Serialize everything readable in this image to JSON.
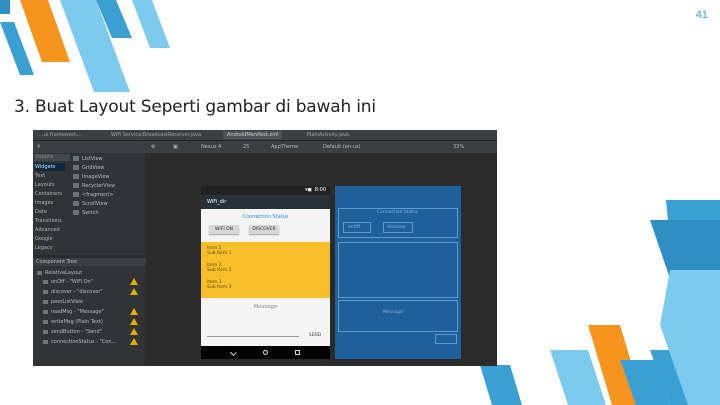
{
  "slide": {
    "page_number": "41",
    "title": "3. Buat Layout Seperti gambar di bawah ini"
  },
  "colors": {
    "accent_blue": "#3aa0d4",
    "accent_light_blue": "#7ccbee",
    "accent_orange": "#f7941d",
    "ide_bg": "#2b2b2b",
    "phone_list": "#f9bf2b",
    "blueprint": "#1f5f9a"
  },
  "ide": {
    "tabs": [
      "...ui.framework...",
      "WiFi Service/BroadcastReceiver.java",
      "AndroidManifest.xml",
      "MainActivity.java"
    ],
    "toolbar": {
      "device": "Nexus 4",
      "api": "25",
      "theme": "AppTheme",
      "language": "Default (en-us)",
      "zoom": "33%"
    },
    "palette": {
      "search_placeholder": "Palette",
      "categories": [
        "Widgets",
        "Text",
        "Layouts",
        "Containers",
        "Images",
        "Date",
        "Transitions",
        "Advanced",
        "Google",
        "Legacy"
      ],
      "items": [
        "ListView",
        "GridView",
        "ImageView",
        "RecyclerView",
        "<fragment>",
        "ScrollView",
        "Switch"
      ]
    },
    "component_tree": {
      "header": "Component Tree",
      "rows": [
        {
          "label": "RelativeLayout",
          "warn": false
        },
        {
          "label": "onOff - \"WiFi On\"",
          "warn": true
        },
        {
          "label": "discover - \"discover\"",
          "warn": true
        },
        {
          "label": "peerListView",
          "warn": false
        },
        {
          "label": "readMsg - \"Message\"",
          "warn": true
        },
        {
          "label": "writeMsg (Plain Text)",
          "warn": true
        },
        {
          "label": "sendButton - \"Send\"",
          "warn": true
        },
        {
          "label": "connectionStatus - \"Con...",
          "warn": true
        }
      ]
    },
    "phone": {
      "status_time": "8:00",
      "app_title": "WiFi_dir",
      "connection_label": "Connection Status",
      "onoff_button": "WIFI ON",
      "discover_button": "DISCOVER",
      "list_items": [
        {
          "title": "Item 1",
          "sub": "Sub Item 1"
        },
        {
          "title": "Item 2",
          "sub": "Sub Item 2"
        },
        {
          "title": "Item 3",
          "sub": "Sub Item 3"
        }
      ],
      "message_hint": "Message",
      "send_button": "SEND"
    },
    "blueprint": {
      "connection_label": "Connection Status",
      "onoff": "onOff",
      "discover": "discover",
      "message": "Message"
    }
  }
}
